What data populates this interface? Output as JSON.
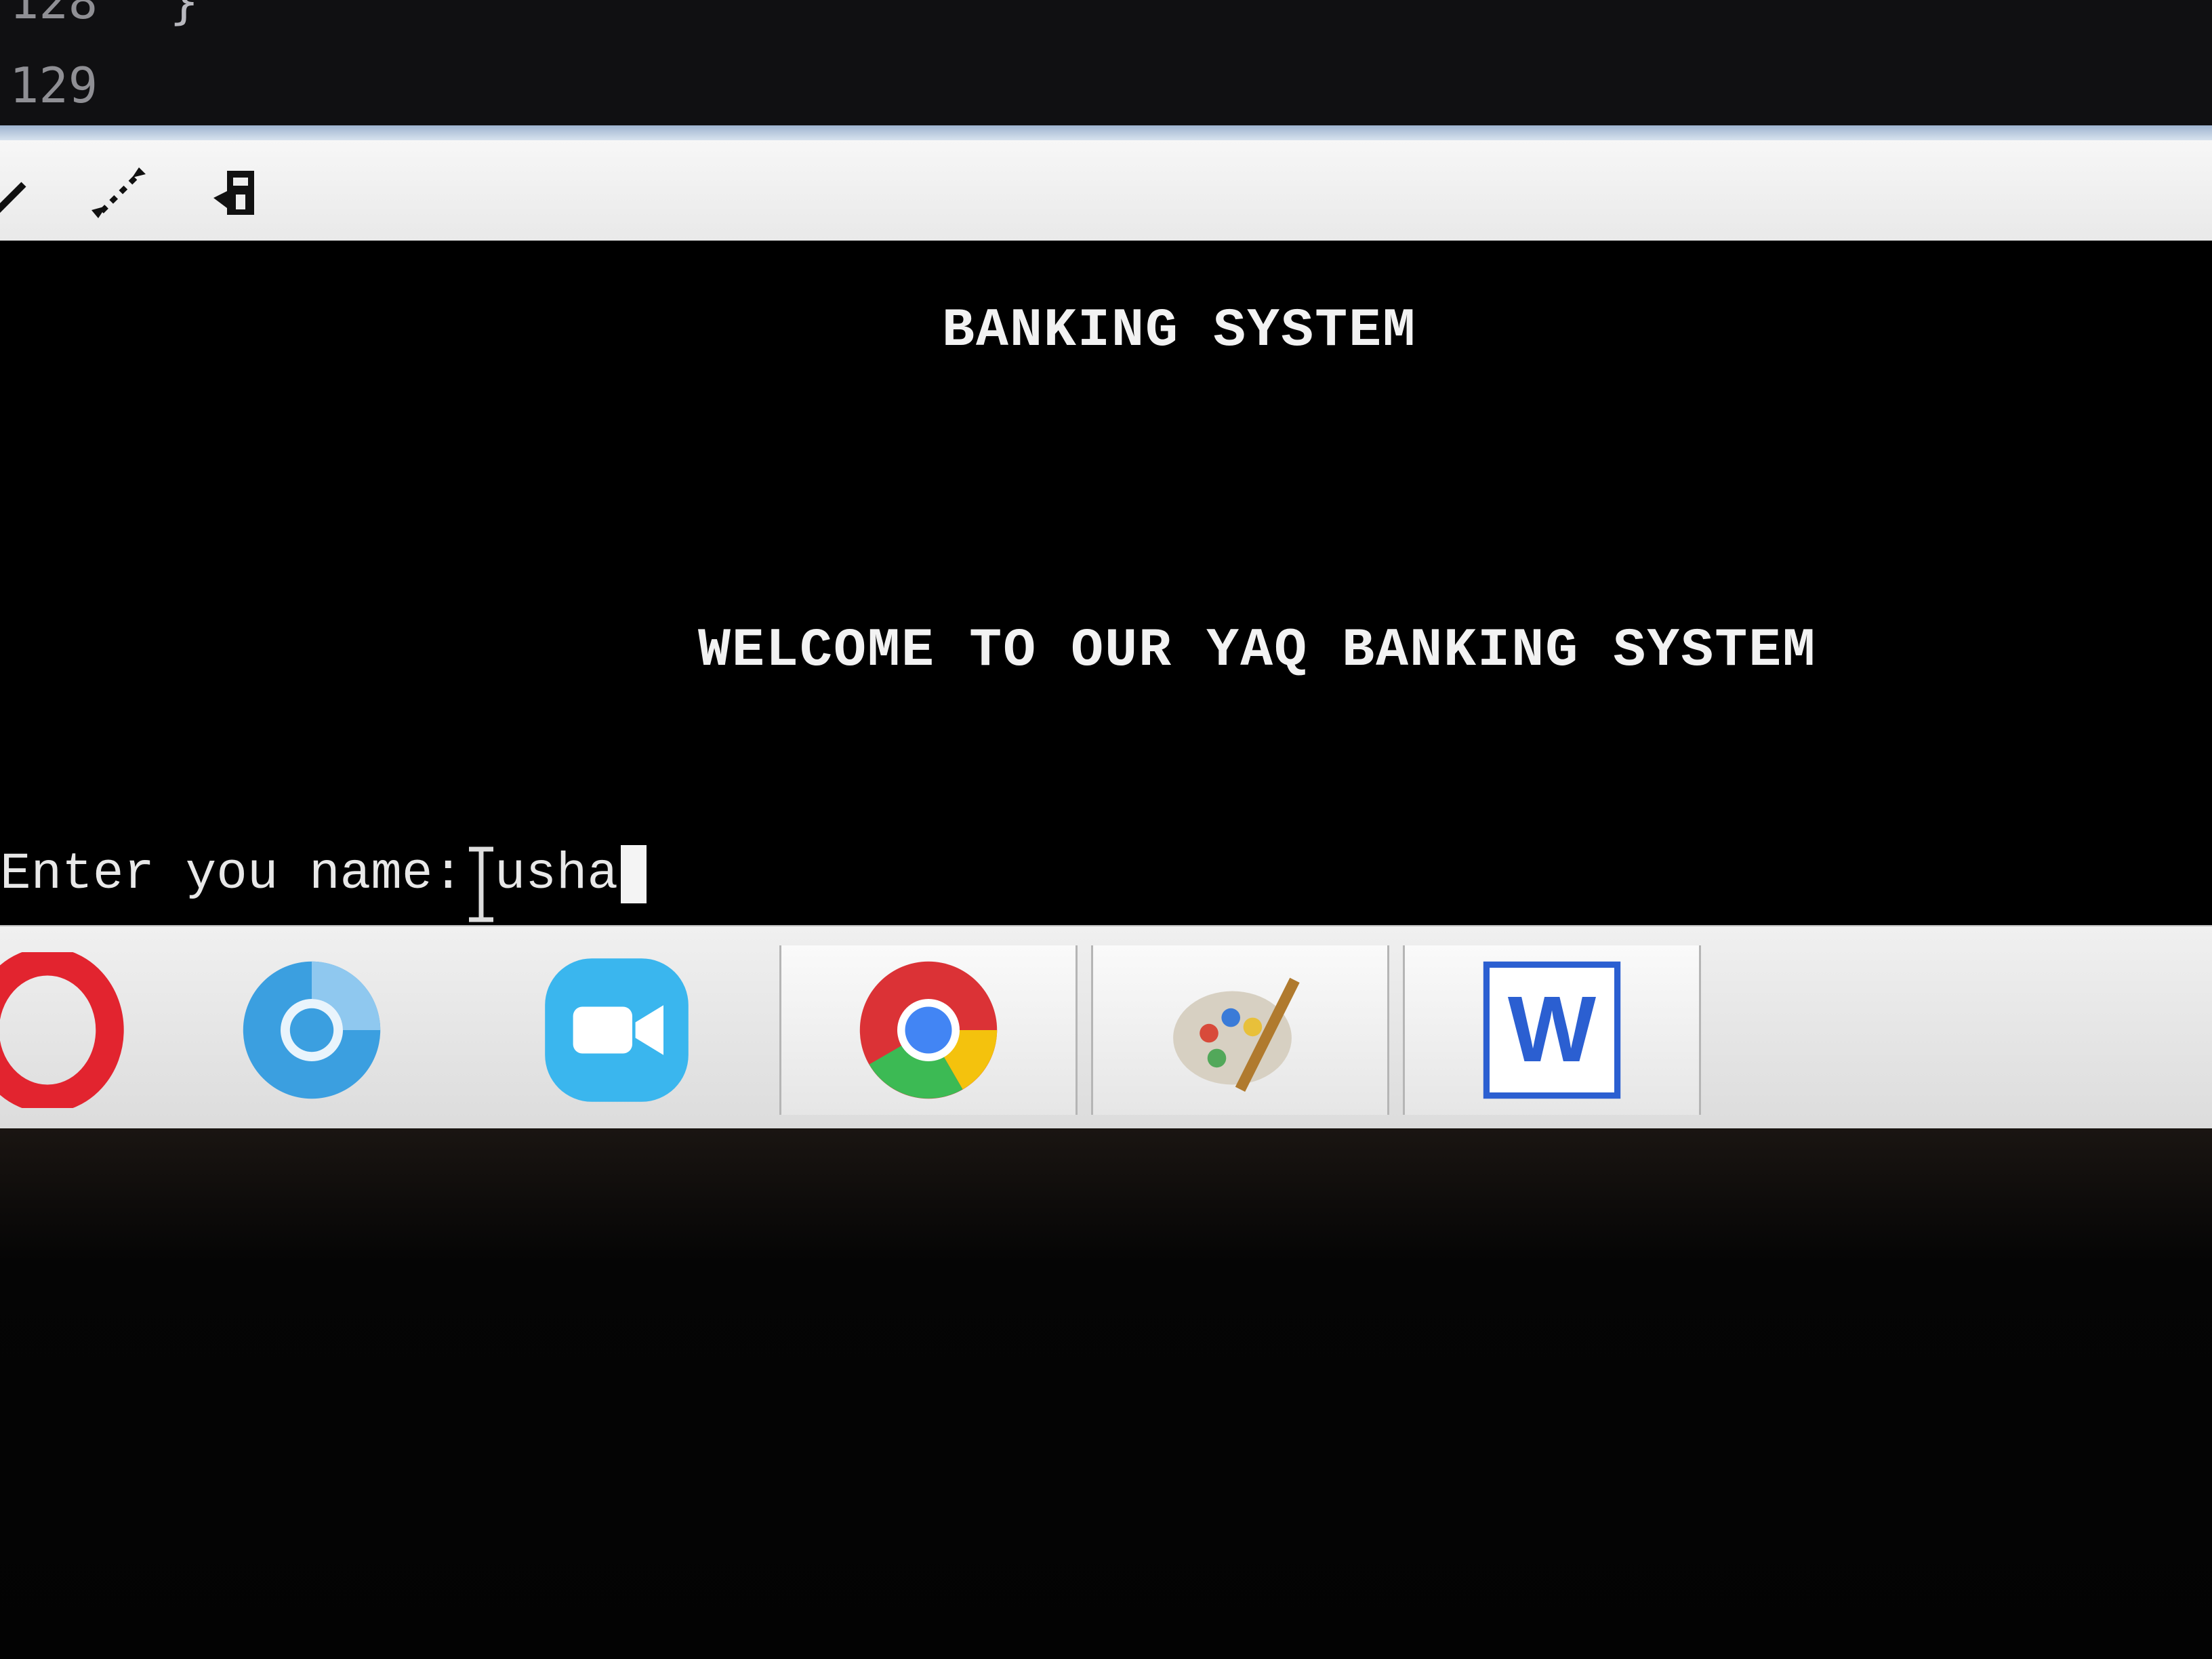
{
  "editor": {
    "line_numbers": [
      "128",
      "129"
    ],
    "code_fragment": "}"
  },
  "toolbar": {
    "icons": [
      "edit-icon",
      "resize-icon",
      "paste-icon"
    ]
  },
  "console": {
    "title": "BANKING SYSTEM",
    "welcome": "WELCOME TO OUR YAQ BANKING SYSTEM",
    "prompt_label": "Enter you name: ",
    "input_value": "usha"
  },
  "taskbar": {
    "apps": [
      "opera-icon",
      "chromium-icon",
      "zoom-icon",
      "chrome-icon",
      "paint-icon",
      "word-icon"
    ],
    "colors": {
      "opera": "#e2242f",
      "chromium": "#3b9fe0",
      "zoom": "#3ab6ee",
      "chrome_red": "#db3236",
      "chrome_green": "#3cba54",
      "chrome_yellow": "#f4c20d",
      "chrome_blue": "#4285f4",
      "word": "#2b5fd1"
    }
  }
}
